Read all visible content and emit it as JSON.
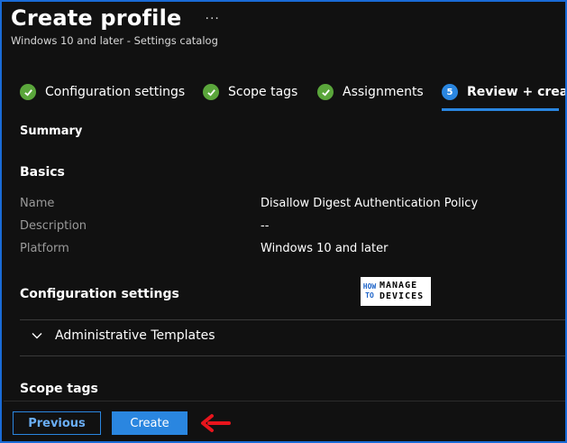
{
  "header": {
    "title": "Create profile",
    "more": "···",
    "subtitle": "Windows 10 and later - Settings catalog"
  },
  "steps": [
    {
      "label": "Configuration settings",
      "state": "complete"
    },
    {
      "label": "Scope tags",
      "state": "complete"
    },
    {
      "label": "Assignments",
      "state": "complete"
    },
    {
      "label": "Review + creat",
      "state": "current",
      "number": "5"
    }
  ],
  "summary": {
    "heading": "Summary",
    "basics_heading": "Basics",
    "fields": [
      {
        "label": "Name",
        "value": "Disallow Digest Authentication Policy"
      },
      {
        "label": "Description",
        "value": "--"
      },
      {
        "label": "Platform",
        "value": "Windows 10 and later"
      }
    ],
    "config_heading": "Configuration settings",
    "accordion_label": "Administrative Templates",
    "scope_heading": "Scope tags"
  },
  "watermark": {
    "left_top": "HOW",
    "left_bottom": "TO",
    "right_top": "MANAGE",
    "right_bottom": "DEVICES"
  },
  "footer": {
    "previous_label": "Previous",
    "create_label": "Create"
  },
  "colors": {
    "accent": "#2a86e0",
    "success": "#5aa63b",
    "annotation_arrow": "#e8141c"
  }
}
